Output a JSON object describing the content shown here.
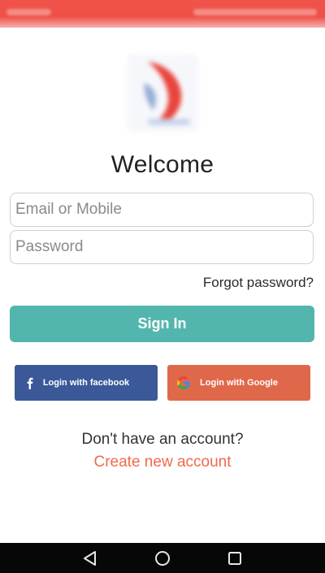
{
  "welcome_title": "Welcome",
  "email_field": {
    "placeholder": "Email or Mobile",
    "value": ""
  },
  "password_field": {
    "placeholder": "Password",
    "value": ""
  },
  "forgot_password_label": "Forgot password?",
  "sign_in_label": "Sign In",
  "facebook_login_label": "Login with facebook",
  "google_login_label": "Login with Google",
  "no_account_text": "Don't have an account?",
  "create_account_label": "Create new account",
  "icons": {
    "facebook": "facebook-icon",
    "google": "google-icon",
    "back": "back-icon",
    "home": "home-icon",
    "recents": "recents-icon"
  },
  "colors": {
    "status_bar": "#ef4f46",
    "sign_in": "#53b6ae",
    "facebook": "#3b5998",
    "google": "#e0684a",
    "create_account": "#ef6a4e",
    "nav_bar": "#070707"
  }
}
